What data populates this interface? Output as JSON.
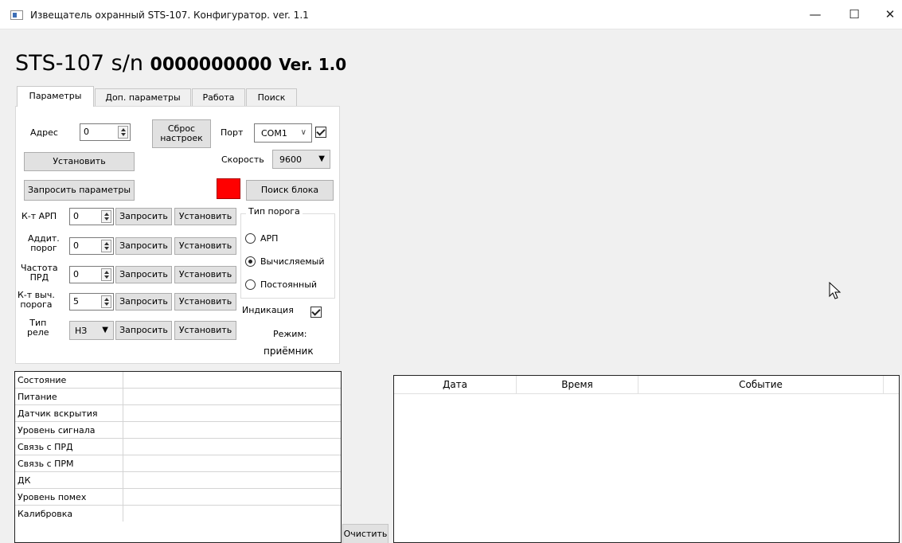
{
  "window": {
    "title": "Извещатель охранный STS-107. Конфигуратор. ver. 1.1",
    "min_glyph": "—",
    "max_glyph": "☐",
    "close_glyph": "✕"
  },
  "header": {
    "model": "STS-107",
    "sn_label": "s/n",
    "serial": "0000000000",
    "version": "Ver. 1.0"
  },
  "tabs": [
    {
      "label": "Параметры",
      "active": true
    },
    {
      "label": "Доп. параметры",
      "active": false
    },
    {
      "label": "Работа",
      "active": false
    },
    {
      "label": "Поиск",
      "active": false
    }
  ],
  "params": {
    "address_label": "Адрес",
    "address_value": "0",
    "reset_label_1": "Сброс",
    "reset_label_2": "настроек",
    "port_label": "Порт",
    "port_value": "COM1",
    "port_checked": true,
    "set_label": "Установить",
    "speed_label": "Скорость",
    "speed_value": "9600",
    "query_params_label": "Запросить параметры",
    "indicator_color": "#ff0000",
    "search_block_label": "Поиск блока",
    "rows": [
      {
        "label_1": "К-т АРП",
        "label_2": "",
        "value": "0",
        "query": "Запросить",
        "set": "Установить"
      },
      {
        "label_1": "Аддит.",
        "label_2": "порог",
        "value": "0",
        "query": "Запросить",
        "set": "Установить"
      },
      {
        "label_1": "Частота",
        "label_2": "ПРД",
        "value": "0",
        "query": "Запросить",
        "set": "Установить"
      },
      {
        "label_1": "К-т выч.",
        "label_2": "порога",
        "value": "5",
        "query": "Запросить",
        "set": "Установить"
      }
    ],
    "relay_label_1": "Тип",
    "relay_label_2": "реле",
    "relay_value": "НЗ",
    "relay_query": "Запросить",
    "relay_set": "Установить",
    "threshold_group_title": "Тип порога",
    "threshold_options": [
      {
        "label": "АРП",
        "selected": false
      },
      {
        "label": "Вычисляемый",
        "selected": true
      },
      {
        "label": "Постоянный",
        "selected": false
      }
    ],
    "indication_label": "Индикация",
    "indication_checked": true,
    "mode_label": "Режим:",
    "mode_value": "приёмник"
  },
  "status": {
    "rows": [
      {
        "name": "Состояние",
        "value": ""
      },
      {
        "name": "Питание",
        "value": ""
      },
      {
        "name": "Датчик вскрытия",
        "value": ""
      },
      {
        "name": "Уровень сигнала",
        "value": ""
      },
      {
        "name": "Связь с ПРД",
        "value": ""
      },
      {
        "name": "Связь с ПРМ",
        "value": ""
      },
      {
        "name": "ДК",
        "value": ""
      },
      {
        "name": "Уровень помех",
        "value": ""
      },
      {
        "name": "Калибровка",
        "value": ""
      }
    ]
  },
  "clear_label": "Очистить",
  "events": {
    "columns": [
      "Дата",
      "Время",
      "Событие"
    ],
    "rows": []
  }
}
